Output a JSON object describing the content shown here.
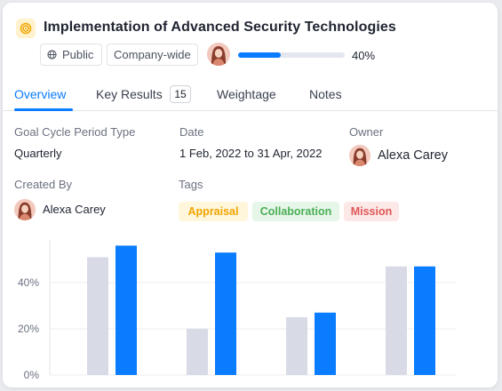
{
  "goal": {
    "icon": "target-icon",
    "title": "Implementation of Advanced Security Technologies",
    "visibility": "Public",
    "scope": "Company-wide",
    "progress_percent": 40,
    "progress_label": "40%"
  },
  "tabs": [
    {
      "label": "Overview",
      "active": true
    },
    {
      "label": "Key Results",
      "count": "15"
    },
    {
      "label": "Weightage"
    },
    {
      "label": "Notes"
    }
  ],
  "details": {
    "cycle_label": "Goal Cycle Period Type",
    "cycle_value": "Quarterly",
    "date_label": "Date",
    "date_value": "1 Feb, 2022 to 31 Apr, 2022",
    "owner_label": "Owner",
    "owner_name": "Alexa Carey",
    "created_label": "Created By",
    "created_name": "Alexa Carey",
    "tags_label": "Tags",
    "tags": [
      "Appraisal",
      "Collaboration",
      "Mission"
    ]
  },
  "colors": {
    "accent": "#0a7cff",
    "bar_gray": "#d8dae6",
    "bar_blue": "#0a7cff",
    "tag_appraisal": "#f0a500",
    "tag_collaboration": "#4caf58",
    "tag_mission": "#e05858"
  },
  "chart_data": {
    "type": "bar",
    "categories": [
      "",
      "",
      "",
      ""
    ],
    "series": [
      {
        "values": [
          51,
          20,
          25,
          47
        ]
      },
      {
        "values": [
          56,
          53,
          27,
          47
        ]
      }
    ],
    "y_ticks": [
      "0%",
      "20%",
      "40%"
    ],
    "ylim": [
      0,
      60
    ],
    "grid": true
  }
}
